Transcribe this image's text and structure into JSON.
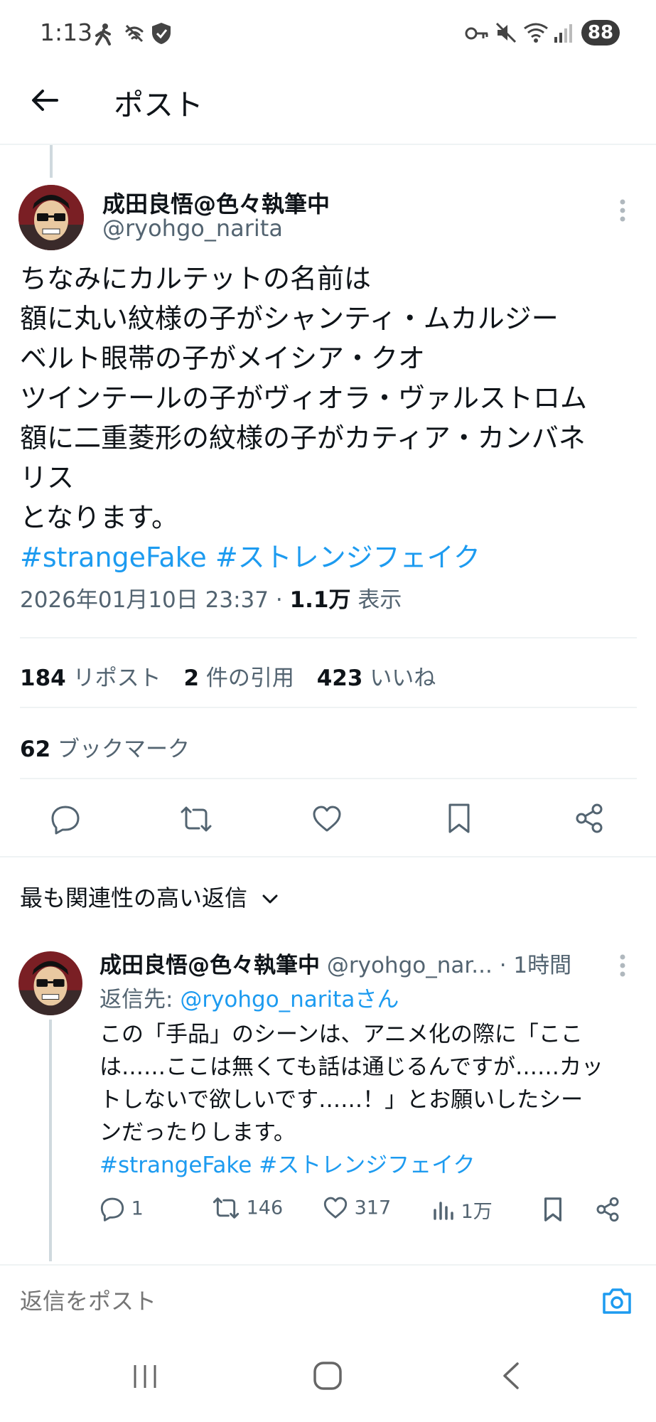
{
  "status_bar": {
    "time": "1:13",
    "battery": "88"
  },
  "header": {
    "title": "ポスト"
  },
  "post": {
    "author_name": "成田良悟@色々執筆中",
    "author_handle": "@ryohgo_narita",
    "lines": [
      "ちなみにカルテットの名前は",
      "額に丸い紋様の子がシャンティ・ムカルジー",
      "ベルト眼帯の子がメイシア・クオ",
      "ツインテールの子がヴィオラ・ヴァルストロム",
      "額に二重菱形の紋様の子がカティア・カンバネ",
      "リス",
      "となります。"
    ],
    "hashtags": [
      "#strangeFake",
      "#ストレンジフェイク"
    ],
    "timestamp": "2026年01月10日 23:37",
    "separator": "·",
    "views_count": "1.1万",
    "views_label": "表示"
  },
  "stats": {
    "reposts_count": "184",
    "reposts_label": "リポスト",
    "quotes_count": "2",
    "quotes_label": "件の引用",
    "likes_count": "423",
    "likes_label": "いいね",
    "bookmarks_count": "62",
    "bookmarks_label": "ブックマーク"
  },
  "actions": {
    "icons": [
      "reply-icon",
      "retweet-icon",
      "like-icon",
      "bookmark-icon",
      "share-icon"
    ]
  },
  "replies_sort": {
    "label": "最も関連性の高い返信"
  },
  "reply": {
    "author_name": "成田良悟@色々執筆中",
    "author_handle": "@ryohgo_nar...",
    "time": "· 1時間",
    "reply_to_prefix": "返信先:",
    "reply_to_handle": "@ryohgo_naritaさん",
    "lines": [
      "この「手品」のシーンは、アニメ化の際に「ここ",
      "は……ここは無くても話は通じるんですが……カッ",
      "トしないで欲しいです……！」とお願いしたシー",
      "ンだったりします。"
    ],
    "hashtags": [
      "#strangeFake",
      "#ストレンジフェイク"
    ],
    "reply_count": "1",
    "retweet_count": "146",
    "like_count": "317",
    "views_count": "1万"
  },
  "compose": {
    "placeholder": "返信をポスト"
  },
  "colors": {
    "accent": "#1d9bf0",
    "text": "#0f1419",
    "muted": "#536471",
    "divider": "#eff3f4"
  }
}
